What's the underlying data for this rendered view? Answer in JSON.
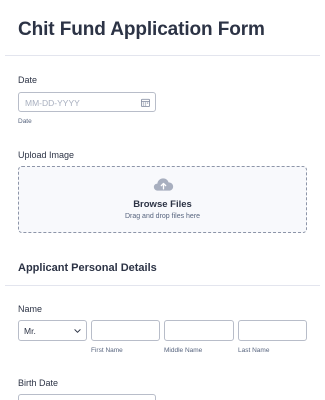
{
  "form": {
    "title": "Chit Fund Application Form"
  },
  "date_field": {
    "label": "Date",
    "placeholder": "MM-DD-YYYY",
    "sublabel": "Date"
  },
  "upload": {
    "label": "Upload Image",
    "browse_label": "Browse Files",
    "hint": "Drag and drop files here"
  },
  "section": {
    "title": "Applicant Personal Details"
  },
  "name_field": {
    "label": "Name",
    "prefix_value": "Mr.",
    "first_sublabel": "First Name",
    "middle_sublabel": "Middle Name",
    "last_sublabel": "Last Name"
  },
  "birth_date": {
    "label": "Birth Date"
  },
  "icons": {
    "calendar": "calendar-icon",
    "upload": "cloud-upload-icon",
    "dropdown": "chevron-down-icon"
  },
  "colors": {
    "text": "#2c3345",
    "muted": "#57647e",
    "border": "#b8bdc9",
    "dashed_border": "#8d95a8"
  }
}
